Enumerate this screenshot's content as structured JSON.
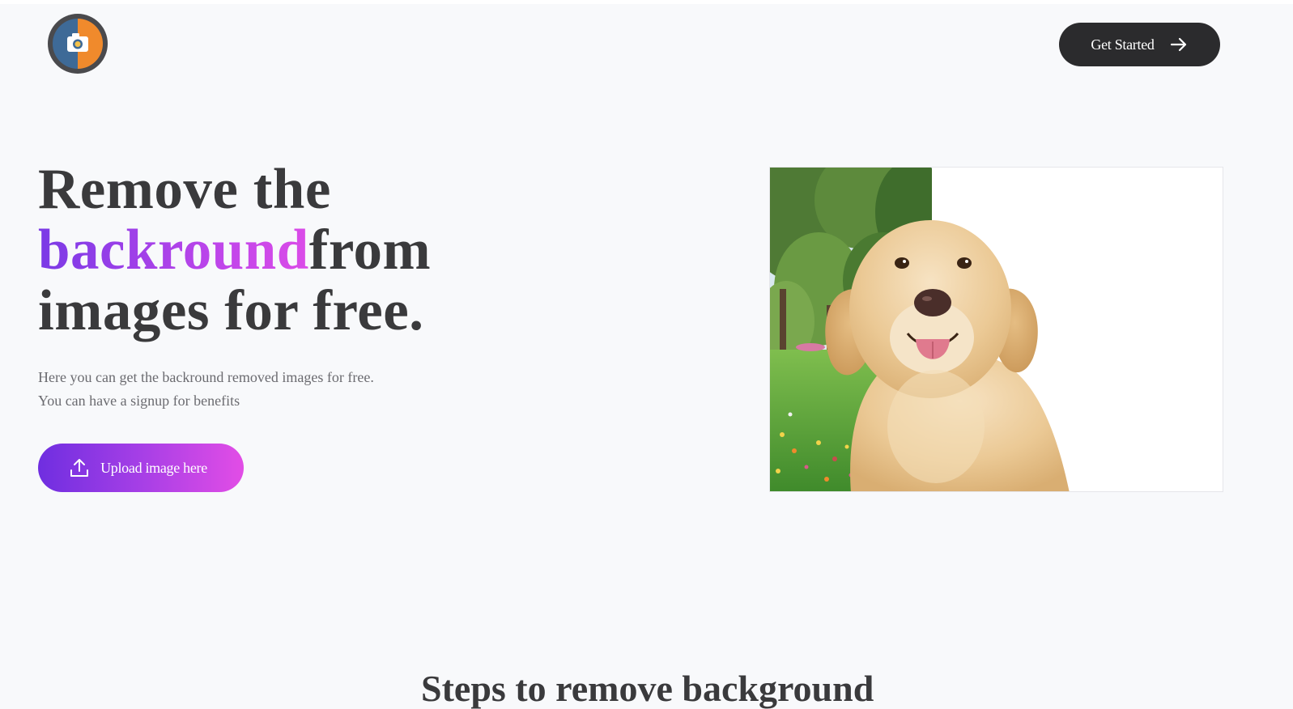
{
  "header": {
    "logo_icon": "camera-logo-icon",
    "cta_label": "Get Started",
    "cta_icon": "arrow-right-icon"
  },
  "hero": {
    "title_line1": "Remove the",
    "title_highlight": "backround",
    "title_line2_rest": "from",
    "title_line3": "images for free.",
    "subtitle_line1": "Here you can get the backround removed images for free.",
    "subtitle_line2": "You can have a signup for benefits",
    "upload_label": "Upload image here",
    "upload_icon": "upload-icon",
    "image_subject": "golden retriever dog with park background partially removed"
  },
  "next_section": {
    "heading": "Steps to remove background"
  },
  "colors": {
    "page_bg": "#f8f9fb",
    "text_dark": "#3a3a3c",
    "text_muted": "#6b6b70",
    "button_dark": "#2b2b2d",
    "gradient_start": "#6f2ee0",
    "gradient_end": "#e24de6",
    "logo_blue": "#3e6a97",
    "logo_orange": "#f08a2c"
  }
}
